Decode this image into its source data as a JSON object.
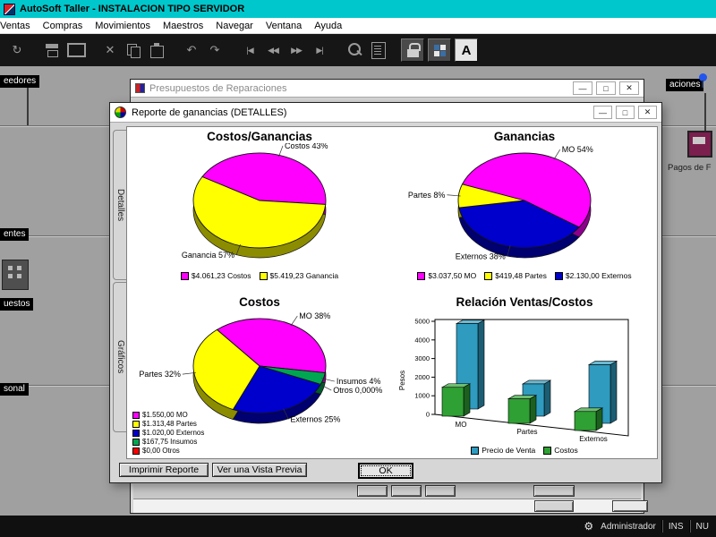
{
  "titlebar": {
    "title": "AutoSoft Taller - INSTALACION TIPO SERVIDOR"
  },
  "menubar": {
    "items": [
      "Ventas",
      "Compras",
      "Movimientos",
      "Maestros",
      "Navegar",
      "Ventana",
      "Ayuda"
    ]
  },
  "toolbar": {
    "icons": [
      {
        "name": "refresh-icon",
        "glyph": "↻"
      },
      {
        "name": "print-icon",
        "glyph": ""
      },
      {
        "name": "monitor-icon",
        "glyph": ""
      },
      {
        "name": "cut-icon",
        "glyph": "✕"
      },
      {
        "name": "copy-icon",
        "glyph": ""
      },
      {
        "name": "paste-icon",
        "glyph": ""
      },
      {
        "name": "undo-icon",
        "glyph": "↶"
      },
      {
        "name": "redo-icon",
        "glyph": "↷"
      },
      {
        "name": "first-record-icon",
        "glyph": "|◀"
      },
      {
        "name": "prev-record-icon",
        "glyph": "◀◀"
      },
      {
        "name": "next-record-icon",
        "glyph": "▶▶"
      },
      {
        "name": "last-record-icon",
        "glyph": "▶|"
      },
      {
        "name": "search-icon",
        "glyph": ""
      },
      {
        "name": "form-icon",
        "glyph": ""
      },
      {
        "name": "lock-icon",
        "glyph": ""
      },
      {
        "name": "tiles-icon",
        "glyph": ""
      },
      {
        "name": "font-icon",
        "glyph": "A"
      }
    ]
  },
  "desktop": {
    "label_proveedores": "eedores",
    "label_clientes": "entes",
    "label_presupuestos": "uestos",
    "label_personal": "sonal",
    "label_reparaciones": "aciones",
    "label_pagos": "Pagos de F"
  },
  "window_buttons": {
    "minimize": "—",
    "maximize": "□",
    "close": "✕"
  },
  "dialog_presupuestos": {
    "title": "Presupuestos de Reparaciones"
  },
  "dialog_reporte": {
    "title": "Reporte de ganancias (DETALLES)",
    "tab_detalles": "Detalles",
    "tab_graficos": "Gráficos",
    "print_button": "Imprimir Reporte",
    "preview_button": "Ver una Vista Previa",
    "ok_button": "OK"
  },
  "statusbar": {
    "user": "Administrador",
    "ins": "INS",
    "num": "NU"
  },
  "chart_data": [
    {
      "type": "pie",
      "title": "Costos/Ganancias",
      "start_angle": 300,
      "draw_sequence": [
        0,
        1
      ],
      "legend_layout": "row",
      "legend_position": "bottom",
      "slices": [
        {
          "name": "Costos",
          "label": "Costos 43%",
          "legend": "$4.061,23 Costos",
          "value": 43,
          "color": "#FF00FF"
        },
        {
          "name": "Ganancia",
          "label": "Ganancia 57%",
          "legend": "$5.419,23 Ganancia",
          "value": 57,
          "color": "#FFFF00"
        }
      ]
    },
    {
      "type": "pie",
      "title": "Ganancias",
      "start_angle": 290,
      "draw_sequence": [
        0,
        2,
        1
      ],
      "legend_layout": "row",
      "legend_position": "bottom",
      "slices": [
        {
          "name": "MO",
          "label": "MO 54%",
          "legend": "$3.037,50 MO",
          "value": 54,
          "color": "#FF00FF"
        },
        {
          "name": "Partes",
          "label": "Partes 8%",
          "legend": "$419,48 Partes",
          "value": 8,
          "color": "#FFFF00"
        },
        {
          "name": "Externos",
          "label": "Externos 38%",
          "legend": "$2.130,00 Externos",
          "value": 38,
          "color": "#0000CC"
        }
      ]
    },
    {
      "type": "pie",
      "title": "Costos",
      "start_angle": 320,
      "draw_sequence": [
        0,
        3,
        4,
        2,
        1
      ],
      "legend_layout": "column",
      "legend_position": "bottom-left",
      "slices": [
        {
          "name": "MO",
          "label": "MO 38%",
          "legend": "$1.550,00 MO",
          "value": 38,
          "color": "#FF00FF"
        },
        {
          "name": "Partes",
          "label": "Partes 32%",
          "legend": "$1.313,48 Partes",
          "value": 32,
          "color": "#FFFF00"
        },
        {
          "name": "Externos",
          "label": "Externos 25%",
          "legend": "$1.020,00 Externos",
          "value": 25,
          "color": "#0000CC"
        },
        {
          "name": "Insumos",
          "label": "Insumos 4%",
          "legend": "$167,75 Insumos",
          "value": 4,
          "color": "#00A651"
        },
        {
          "name": "Otros",
          "label": "Otros 0,000%",
          "legend": "$0,00 Otros",
          "value": 0,
          "color": "#FF0000"
        }
      ]
    },
    {
      "type": "bar",
      "title": "Relación Ventas/Costos",
      "ylabel": "Pesos",
      "categories": [
        "MO",
        "Partes",
        "Externos"
      ],
      "series": [
        {
          "name": "Precio de Venta",
          "color": "#2E9BBF",
          "values": [
            4587.5,
            1732.96,
            3150.0
          ]
        },
        {
          "name": "Costos",
          "color": "#2FA033",
          "values": [
            1550.0,
            1313.48,
            1020.0
          ]
        }
      ],
      "ylim": [
        0,
        5000
      ],
      "yticks": [
        0,
        1000,
        2000,
        3000,
        4000,
        5000
      ],
      "legend_position": "bottom"
    }
  ]
}
